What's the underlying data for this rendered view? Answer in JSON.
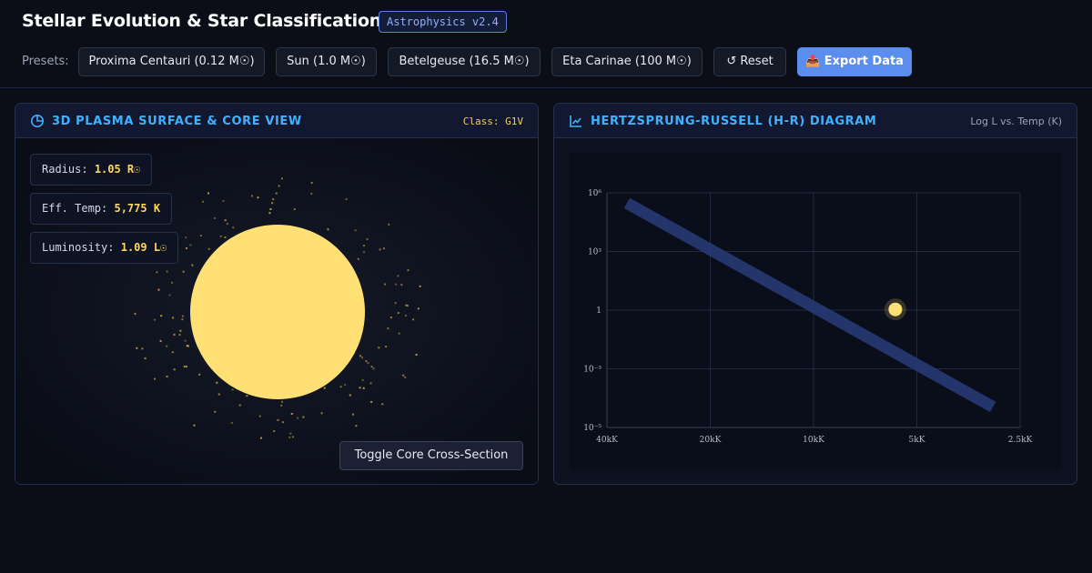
{
  "header": {
    "title": "Stellar Evolution & Star Classification Lab",
    "version": "Astrophysics v2.4"
  },
  "presets": {
    "label": "Presets:",
    "items": [
      {
        "label": "Proxima Centauri (0.12 M☉)"
      },
      {
        "label": "Sun (1.0 M☉)"
      },
      {
        "label": "Betelgeuse (16.5 M☉)"
      },
      {
        "label": "Eta Carinae (100 M☉)"
      }
    ],
    "reset_label": "↺ Reset",
    "export_label": "📤 Export Data"
  },
  "surface_panel": {
    "title": "3D PLASMA SURFACE & CORE VIEW",
    "class_label": "Class: G1V",
    "stats": {
      "radius": {
        "label": "Radius:",
        "value": "1.05 R☉"
      },
      "temp": {
        "label": "Eff. Temp:",
        "value": "5,775 K"
      },
      "luminosity": {
        "label": "Luminosity:",
        "value": "1.09 L☉"
      }
    },
    "toggle_label": "Toggle Core Cross-Section",
    "star_color": "#ffe075"
  },
  "hr_panel": {
    "title": "HERTZSPRUNG-RUSSELL (H-R) DIAGRAM",
    "subtitle": "Log L vs. Temp (K)"
  },
  "chart_data": {
    "type": "scatter",
    "title": "",
    "xlabel": "",
    "ylabel": "",
    "x_ticks": [
      "40kK",
      "20kK",
      "10kK",
      "5kK",
      "2.5kK"
    ],
    "y_ticks": [
      "10⁶",
      "10³",
      "1",
      "10⁻³",
      "10⁻⁵"
    ],
    "x_scale": "log, reversed",
    "xlim": [
      40000,
      2500
    ],
    "y_scale": "log",
    "grid": true,
    "main_sequence_band": {
      "x": [
        35000,
        3000
      ],
      "y": [
        300000,
        5e-05
      ]
    },
    "star_point": {
      "x": 5775,
      "y": 1.09
    },
    "colors": {
      "band": "#263a73",
      "star": "#ffe075"
    }
  }
}
